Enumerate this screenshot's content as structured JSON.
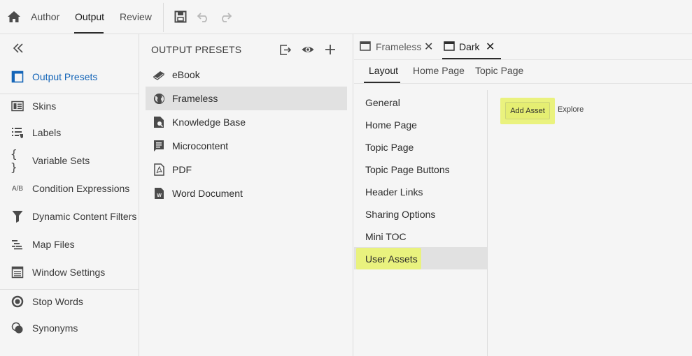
{
  "topbar": {
    "tabs": [
      {
        "label": "Author",
        "active": false
      },
      {
        "label": "Output",
        "active": true
      },
      {
        "label": "Review",
        "active": false
      }
    ],
    "icons": [
      "home-icon",
      "save-icon",
      "undo-icon",
      "redo-icon"
    ]
  },
  "sidebar": {
    "collapse_icon": "chevron-double-left-icon",
    "items": [
      {
        "label": "Output Presets",
        "icon": "output-presets-icon",
        "active": true
      },
      {
        "label": "Skins",
        "icon": "skins-icon"
      },
      {
        "label": "Labels",
        "icon": "labels-icon"
      },
      {
        "label": "Variable Sets",
        "icon": "braces-icon"
      },
      {
        "label": "Condition Expressions",
        "icon": "ab-icon",
        "icon_text": "A/B"
      },
      {
        "label": "Dynamic Content Filters",
        "icon": "filter-icon"
      },
      {
        "label": "Map Files",
        "icon": "map-files-icon"
      },
      {
        "label": "Window Settings",
        "icon": "window-settings-icon"
      },
      {
        "label": "Stop Words",
        "icon": "stop-words-icon"
      },
      {
        "label": "Synonyms",
        "icon": "synonyms-icon"
      }
    ]
  },
  "presets": {
    "title": "OUTPUT PRESETS",
    "header_icons": [
      "export-icon",
      "preview-eye-icon",
      "add-icon"
    ],
    "items": [
      {
        "label": "eBook",
        "icon": "ebook-icon"
      },
      {
        "label": "Frameless",
        "icon": "globe-icon",
        "selected": true
      },
      {
        "label": "Knowledge Base",
        "icon": "knowledge-base-icon"
      },
      {
        "label": "Microcontent",
        "icon": "microcontent-icon"
      },
      {
        "label": "PDF",
        "icon": "pdf-icon"
      },
      {
        "label": "Word Document",
        "icon": "word-document-icon"
      }
    ]
  },
  "editor": {
    "doc_tabs": [
      {
        "label": "Frameless",
        "close": "✕",
        "active": false
      },
      {
        "label": "Dark",
        "close": "✕",
        "active": true
      }
    ],
    "sub_tabs": [
      {
        "label": "Layout",
        "active": true
      },
      {
        "label": "Home Page",
        "active": false
      },
      {
        "label": "Topic Page",
        "active": false
      }
    ],
    "sections": [
      {
        "label": "General"
      },
      {
        "label": "Home Page"
      },
      {
        "label": "Topic Page"
      },
      {
        "label": "Topic Page Buttons"
      },
      {
        "label": "Header Links"
      },
      {
        "label": "Sharing Options"
      },
      {
        "label": "Mini TOC"
      },
      {
        "label": "User Assets",
        "selected": true
      }
    ],
    "content": {
      "add_asset_label": "Add Asset",
      "explore_label": "Explore"
    },
    "highlight_color": "#e9f27e"
  }
}
